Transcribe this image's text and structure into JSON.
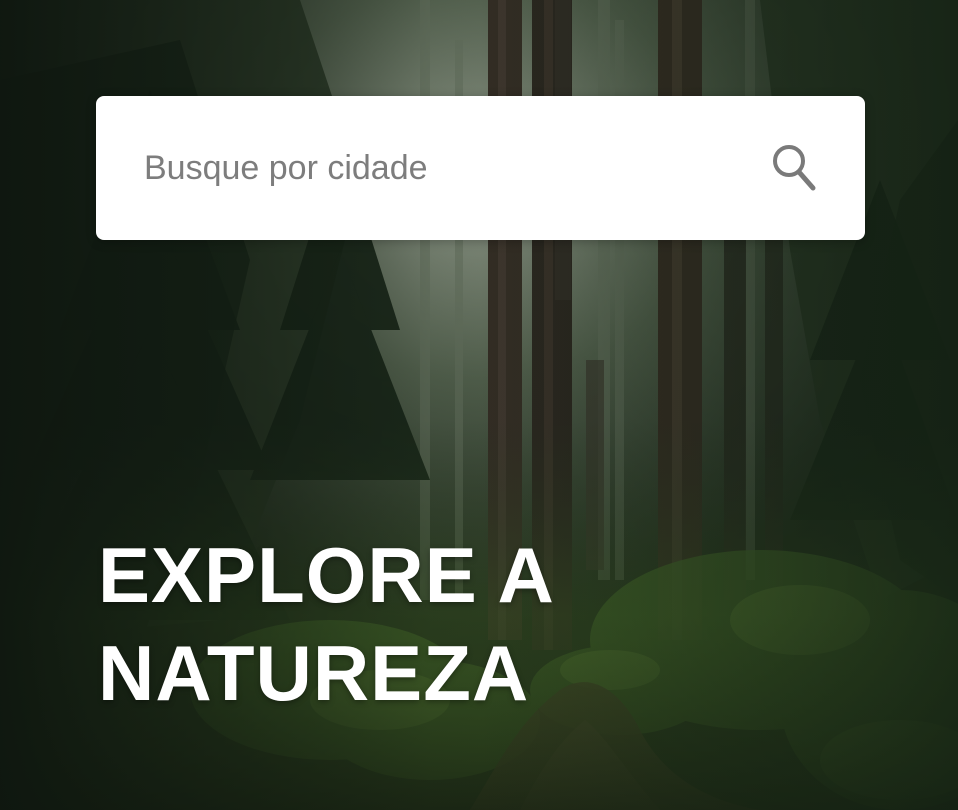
{
  "search": {
    "placeholder": "Busque por cidade",
    "value": "",
    "icon": "search-icon"
  },
  "headline": {
    "line1": "EXPLORE A",
    "line2": "NATUREZA"
  },
  "background": {
    "image": "forest-photo",
    "colors": {
      "dark": "#141e14",
      "mid": "#3a4a34",
      "mist": "#9aa592",
      "moss": "#5f8a3a"
    }
  }
}
